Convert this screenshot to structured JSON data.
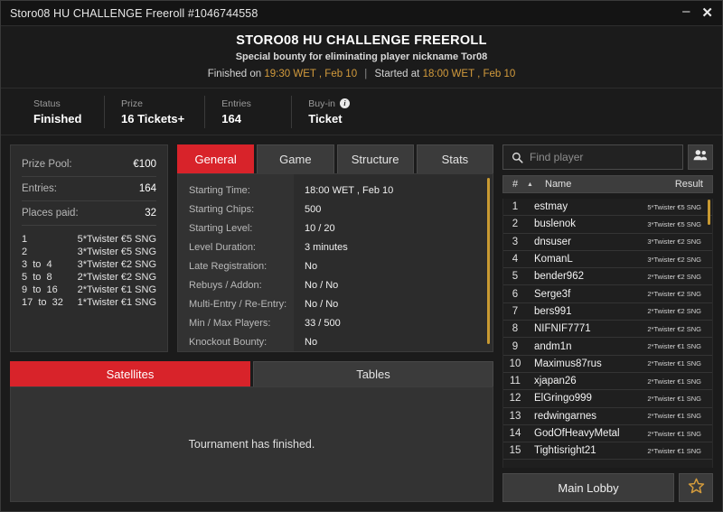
{
  "window": {
    "title": "Storo08 HU CHALLENGE Freeroll #1046744558",
    "minimize_label": "–",
    "close_label": "✕"
  },
  "header": {
    "title": "STORO08 HU CHALLENGE FREEROLL",
    "subtitle": "Special bounty for eliminating player nickname Tor08",
    "finished_prefix": "Finished on",
    "finished_value": "19:30 WET , Feb 10",
    "separator": "|",
    "started_prefix": "Started at",
    "started_value": "18:00 WET , Feb 10"
  },
  "status_strip": [
    {
      "label": "Status",
      "value": "Finished",
      "info": false
    },
    {
      "label": "Prize",
      "value": "16 Tickets+",
      "info": false
    },
    {
      "label": "Entries",
      "value": "164",
      "info": false
    },
    {
      "label": "Buy-in",
      "value": "Ticket",
      "info": true,
      "info_glyph": "i"
    }
  ],
  "prize_panel": {
    "rows": [
      {
        "key": "Prize Pool:",
        "value": "€100"
      },
      {
        "key": "Entries:",
        "value": "164"
      },
      {
        "key": "Places paid:",
        "value": "32"
      }
    ],
    "payouts": [
      {
        "place": "1",
        "prize": "5*Twister €5 SNG"
      },
      {
        "place": "2",
        "prize": "3*Twister €5 SNG"
      },
      {
        "place": "3  to  4",
        "prize": "3*Twister €2 SNG"
      },
      {
        "place": "5  to  8",
        "prize": "2*Twister €2 SNG"
      },
      {
        "place": "9  to  16",
        "prize": "2*Twister €1 SNG"
      },
      {
        "place": "17  to  32",
        "prize": "1*Twister €1 SNG"
      }
    ]
  },
  "details": {
    "tabs": [
      {
        "label": "General",
        "active": true
      },
      {
        "label": "Game",
        "active": false
      },
      {
        "label": "Structure",
        "active": false
      },
      {
        "label": "Stats",
        "active": false
      }
    ],
    "rows": [
      {
        "label": "Starting Time:",
        "value": "18:00 WET , Feb 10"
      },
      {
        "label": "Starting Chips:",
        "value": "500"
      },
      {
        "label": "Starting Level:",
        "value": "10 / 20"
      },
      {
        "label": "Level Duration:",
        "value": "3 minutes"
      },
      {
        "label": "Late Registration:",
        "value": "No"
      },
      {
        "label": "Rebuys / Addon:",
        "value": "No / No"
      },
      {
        "label": "Multi-Entry / Re-Entry:",
        "value": "No / No"
      },
      {
        "label": "Min / Max Players:",
        "value": "33 / 500"
      },
      {
        "label": "Knockout Bounty:",
        "value": "No"
      }
    ]
  },
  "satellites": {
    "tabs": [
      {
        "label": "Satellites",
        "active": true
      },
      {
        "label": "Tables",
        "active": false
      }
    ],
    "message": "Tournament has finished."
  },
  "players": {
    "search_placeholder": "Find player",
    "search_value": "",
    "search_icon": "search-icon",
    "people_icon": "people-icon",
    "columns": {
      "num": "#",
      "sort": "▲",
      "name": "Name",
      "result": "Result"
    },
    "rows": [
      {
        "num": "1",
        "name": "estmay",
        "result": "5*Twister €5 SNG"
      },
      {
        "num": "2",
        "name": "buslenok",
        "result": "3*Twister €5 SNG"
      },
      {
        "num": "3",
        "name": "dnsuser",
        "result": "3*Twister €2 SNG"
      },
      {
        "num": "4",
        "name": "KomanL",
        "result": "3*Twister €2 SNG"
      },
      {
        "num": "5",
        "name": "bender962",
        "result": "2*Twister €2 SNG"
      },
      {
        "num": "6",
        "name": "Serge3f",
        "result": "2*Twister €2 SNG"
      },
      {
        "num": "7",
        "name": "bers991",
        "result": "2*Twister €2 SNG"
      },
      {
        "num": "8",
        "name": "NIFNIF7771",
        "result": "2*Twister €2 SNG"
      },
      {
        "num": "9",
        "name": "andm1n",
        "result": "2*Twister €1 SNG"
      },
      {
        "num": "10",
        "name": "Maximus87rus",
        "result": "2*Twister €1 SNG"
      },
      {
        "num": "11",
        "name": "xjapan26",
        "result": "2*Twister €1 SNG"
      },
      {
        "num": "12",
        "name": "ElGringo999",
        "result": "2*Twister €1 SNG"
      },
      {
        "num": "13",
        "name": "redwingarnes",
        "result": "2*Twister €1 SNG"
      },
      {
        "num": "14",
        "name": "GodOfHeavyMetal",
        "result": "2*Twister €1 SNG"
      },
      {
        "num": "15",
        "name": "Tightisright21",
        "result": "2*Twister €1 SNG"
      }
    ]
  },
  "footer": {
    "main_lobby_label": "Main Lobby",
    "favorite_icon": "star-icon"
  },
  "colors": {
    "accent_red": "#d8232a",
    "accent_gold": "#d39b3c",
    "panel_bg": "#2c2c2c",
    "window_bg": "#1b1b1b"
  }
}
